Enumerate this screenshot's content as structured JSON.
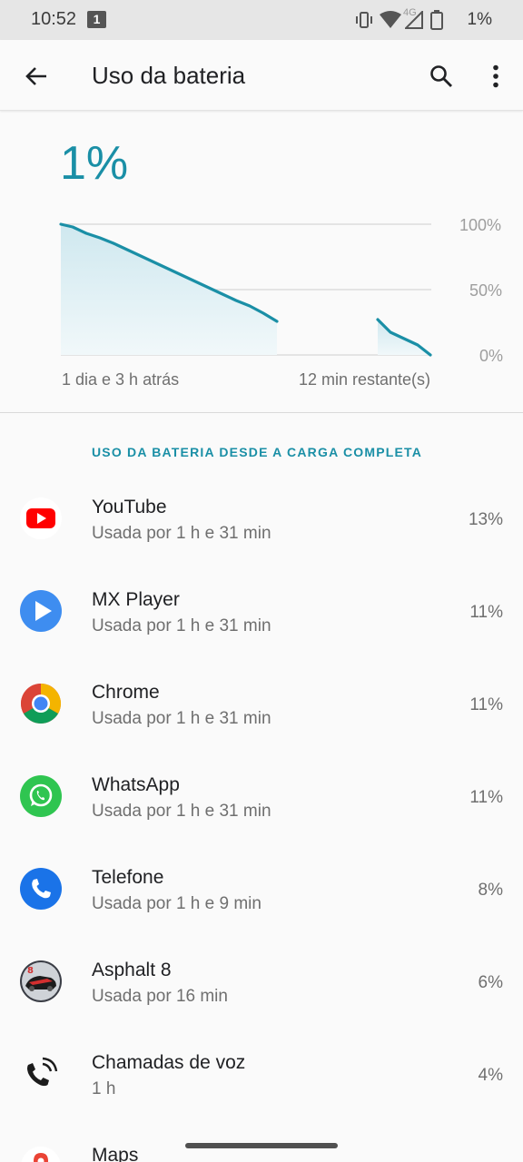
{
  "status_bar": {
    "time": "10:52",
    "notification_badge": "1",
    "network": "4G",
    "battery_percent": "1%"
  },
  "app_bar": {
    "title": "Uso da bateria",
    "icons": [
      "back-arrow-icon",
      "search-icon",
      "more-vert-icon"
    ]
  },
  "battery": {
    "level": "1%",
    "chart": {
      "tick_100": "100%",
      "tick_50": "50%",
      "tick_0": "0%",
      "left_label": "1 dia e 3 h atrás",
      "right_label": "12 min restante(s)",
      "accent": "#1a8fa6"
    }
  },
  "section": {
    "header": "USO DA BATERIA DESDE A CARGA COMPLETA"
  },
  "apps": [
    {
      "name": "YouTube",
      "usage": "Usada por 1 h e 31 min",
      "percent": "13%",
      "icon": "youtube-icon"
    },
    {
      "name": "MX Player",
      "usage": "Usada por 1 h e 31 min",
      "percent": "11%",
      "icon": "mx-player-icon"
    },
    {
      "name": "Chrome",
      "usage": "Usada por 1 h e 31 min",
      "percent": "11%",
      "icon": "chrome-icon"
    },
    {
      "name": "WhatsApp",
      "usage": "Usada por 1 h e 31 min",
      "percent": "11%",
      "icon": "whatsapp-icon"
    },
    {
      "name": "Telefone",
      "usage": "Usada por 1 h e 9 min",
      "percent": "8%",
      "icon": "phone-icon"
    },
    {
      "name": "Asphalt 8",
      "usage": "Usada por 16 min",
      "percent": "6%",
      "icon": "asphalt-icon"
    },
    {
      "name": "Chamadas de voz",
      "usage": "1 h",
      "percent": "4%",
      "icon": "voice-call-icon"
    },
    {
      "name": "Maps",
      "usage": "",
      "percent": "",
      "icon": "maps-icon"
    }
  ]
}
